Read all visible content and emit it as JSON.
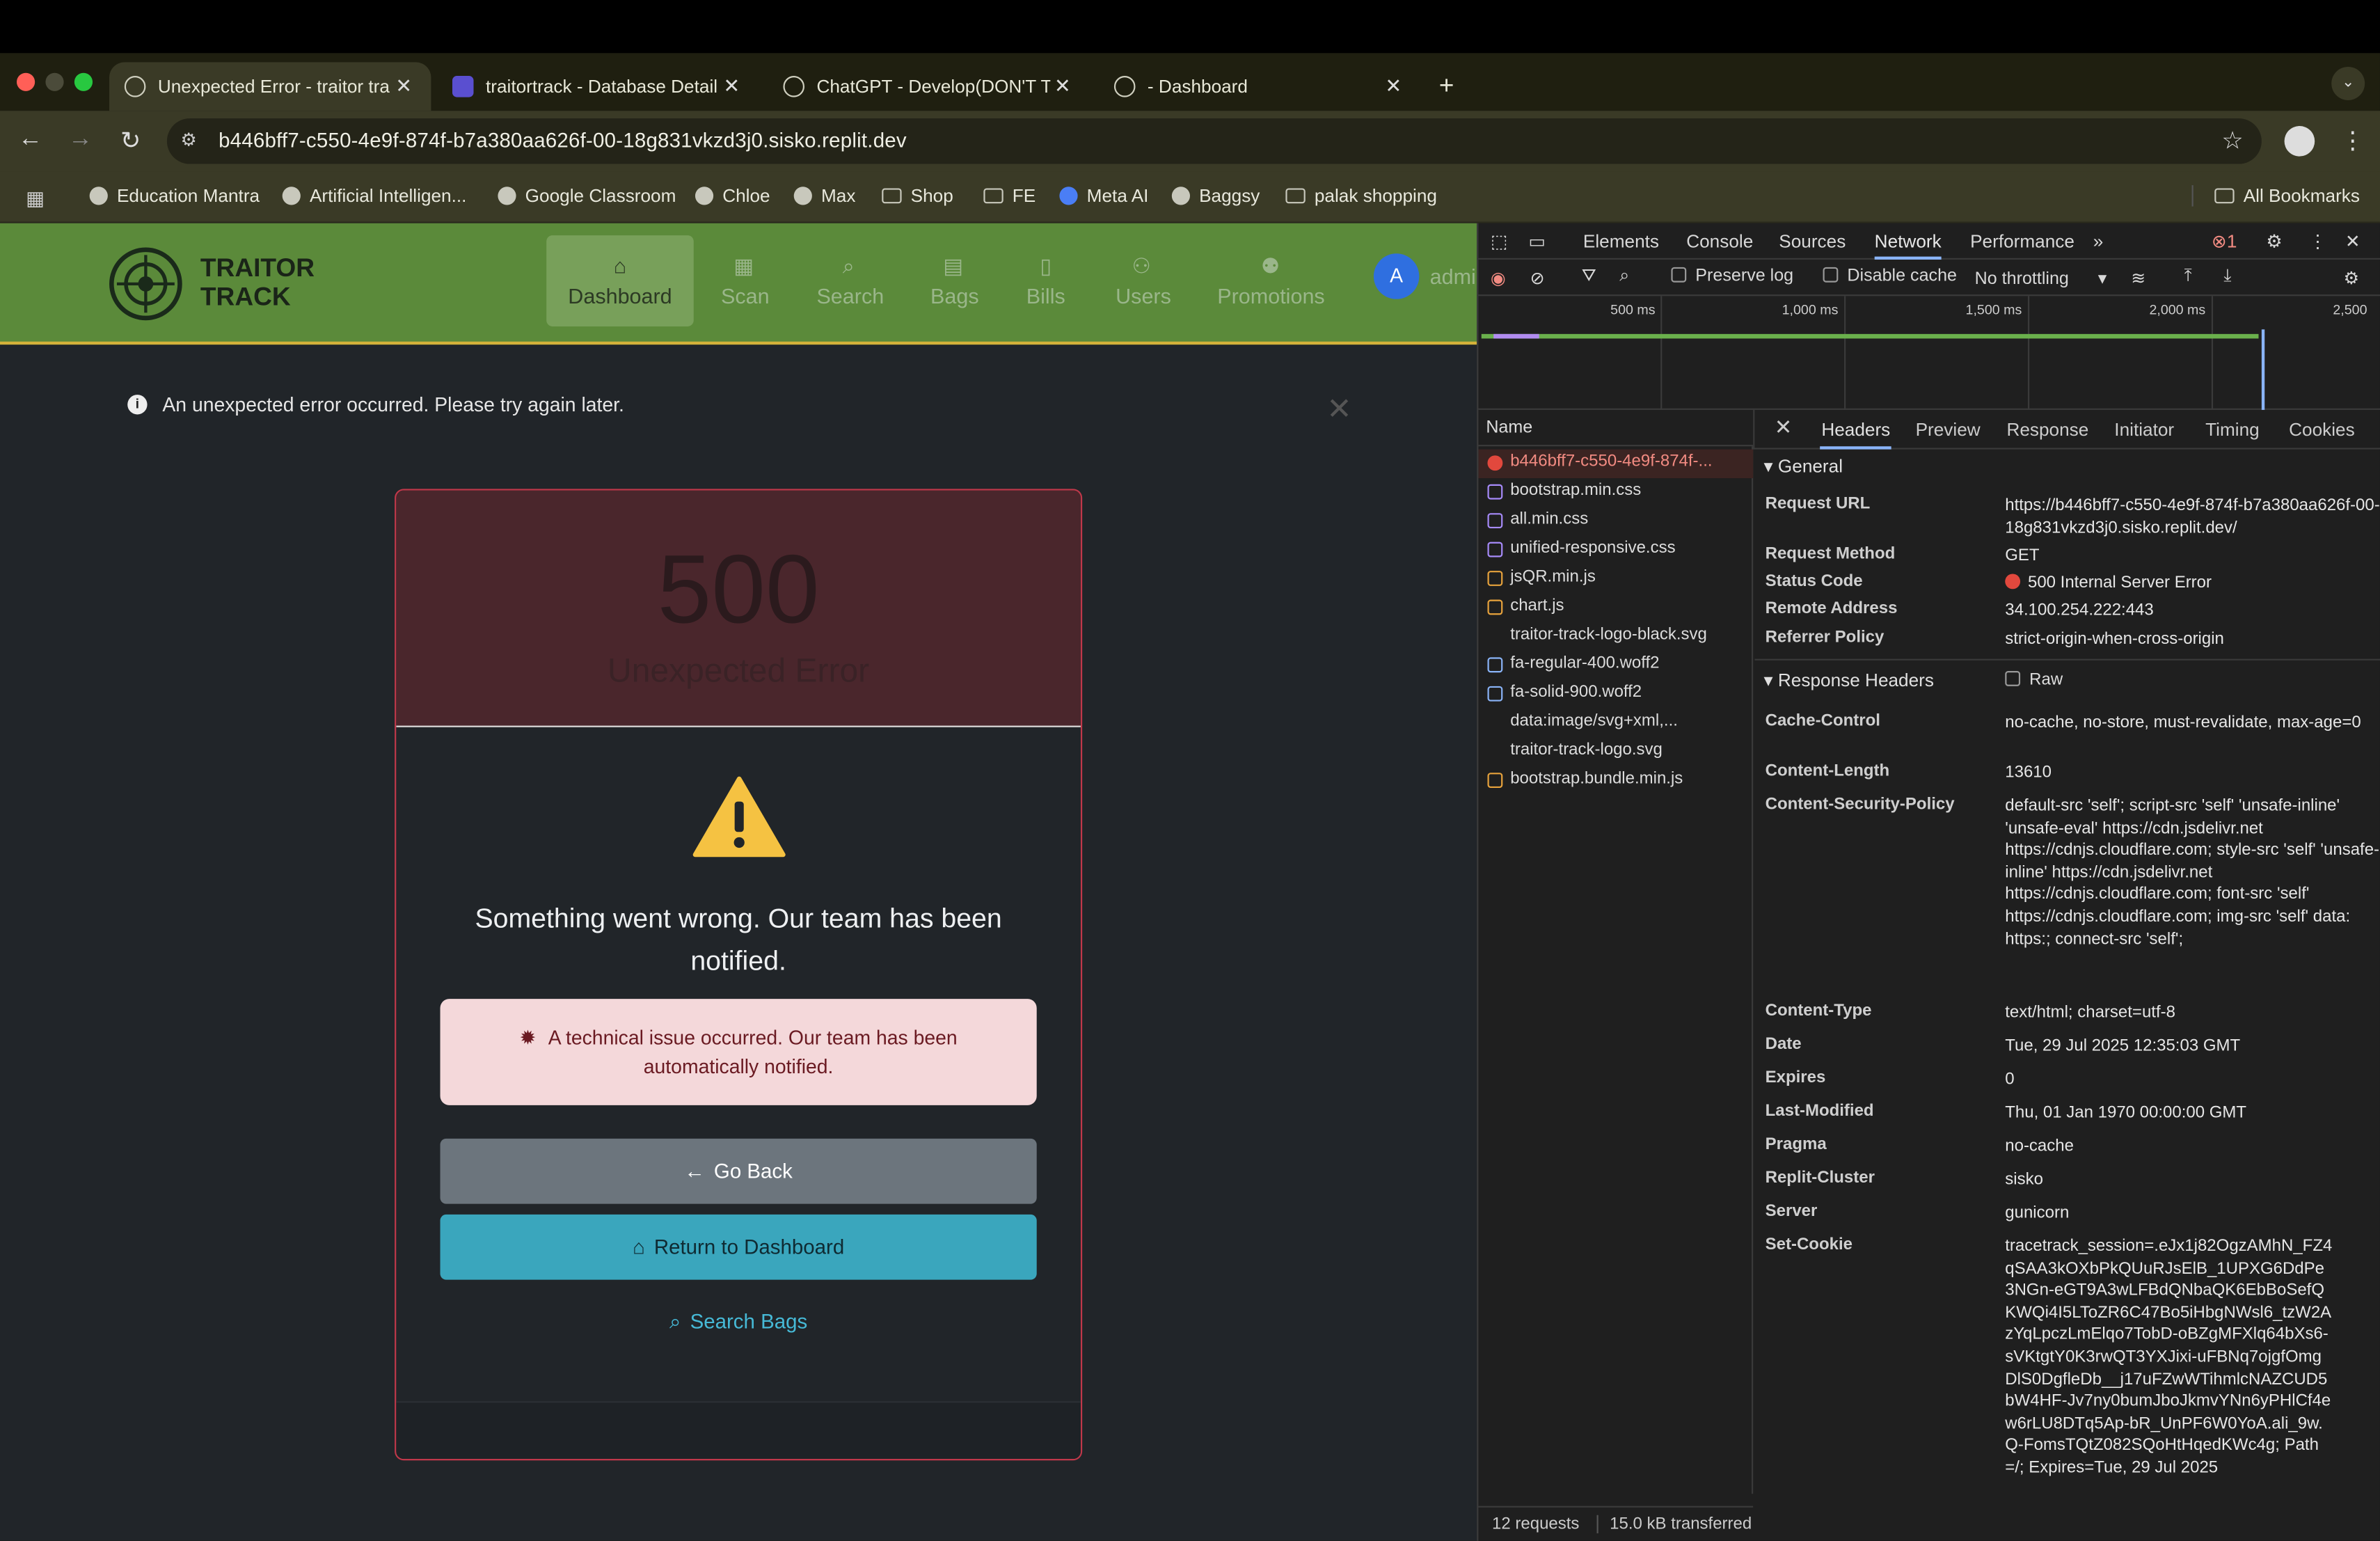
{
  "browser": {
    "tabs": [
      {
        "title": "Unexpected Error - traitor tra",
        "active": true
      },
      {
        "title": "traitortrack - Database Detail",
        "active": false
      },
      {
        "title": "ChatGPT - Develop(DON'T TC",
        "active": false
      },
      {
        "title": "- Dashboard",
        "active": false
      }
    ],
    "new_tab": "+",
    "url": "b446bff7-c550-4e9f-874f-b7a380aa626f-00-18g831vkzd3j0.sisko.replit.dev",
    "bookmarks": [
      "Education Mantra",
      "Artificial Intelligen...",
      "Google Classroom",
      "Chloe",
      "Max",
      "Shop",
      "FE",
      "Meta AI",
      "Baggsy",
      "palak shopping"
    ],
    "all_bookmarks": "All Bookmarks"
  },
  "app": {
    "logo_line1": "TRAITOR",
    "logo_line2": "TRACK",
    "nav": [
      "Dashboard",
      "Scan",
      "Search",
      "Bags",
      "Bills",
      "Users",
      "Promotions"
    ],
    "avatar_letter": "A",
    "user": "admi",
    "alert": "An unexpected error occurred. Please try again later.",
    "alert_close": "✕",
    "error_code": "500",
    "error_title": "Unexpected Error",
    "message": "Something went wrong. Our team has been notified.",
    "tech_notice": "A technical issue occurred. Our team has been automatically notified.",
    "go_back": "Go Back",
    "return_dashboard": "Return to Dashboard",
    "search_bags": "Search Bags"
  },
  "devtools": {
    "tabs": [
      "Elements",
      "Console",
      "Sources",
      "Network",
      "Performance"
    ],
    "more": "»",
    "issue_count": "1",
    "preserve_log": "Preserve log",
    "disable_cache": "Disable cache",
    "throttling": "No throttling",
    "ticks": [
      "500 ms",
      "1,000 ms",
      "1,500 ms",
      "2,000 ms",
      "2,500"
    ],
    "name_header": "Name",
    "requests": [
      {
        "name": "b446bff7-c550-4e9f-874f-...",
        "error": true
      },
      {
        "name": "bootstrap.min.css",
        "error": false
      },
      {
        "name": "all.min.css",
        "error": false
      },
      {
        "name": "unified-responsive.css",
        "error": false
      },
      {
        "name": "jsQR.min.js",
        "error": false
      },
      {
        "name": "chart.js",
        "error": false
      },
      {
        "name": "traitor-track-logo-black.svg",
        "error": false
      },
      {
        "name": "fa-regular-400.woff2",
        "error": false
      },
      {
        "name": "fa-solid-900.woff2",
        "error": false
      },
      {
        "name": "data:image/svg+xml,...",
        "error": false
      },
      {
        "name": "traitor-track-logo.svg",
        "error": false
      },
      {
        "name": "bootstrap.bundle.min.js",
        "error": false
      }
    ],
    "summary_requests": "12 requests",
    "summary_transfer": "15.0 kB transferred",
    "detail_tabs": [
      "Headers",
      "Preview",
      "Response",
      "Initiator",
      "Timing",
      "Cookies"
    ],
    "general_label": "General",
    "general": [
      {
        "k": "Request URL",
        "v": "https://b446bff7-c550-4e9f-874f-b7a380aa626f-00-18g831vkzd3j0.sisko.replit.dev/"
      },
      {
        "k": "Request Method",
        "v": "GET"
      },
      {
        "k": "Status Code",
        "v": "500 Internal Server Error"
      },
      {
        "k": "Remote Address",
        "v": "34.100.254.222:443"
      },
      {
        "k": "Referrer Policy",
        "v": "strict-origin-when-cross-origin"
      }
    ],
    "response_headers_label": "Response Headers",
    "raw_label": "Raw",
    "response_headers": [
      {
        "k": "Cache-Control",
        "v": "no-cache, no-store, must-revalidate, max-age=0"
      },
      {
        "k": "Content-Length",
        "v": "13610"
      },
      {
        "k": "Content-Security-Policy",
        "v": "default-src 'self'; script-src 'self' 'unsafe-inline' 'unsafe-eval' https://cdn.jsdelivr.net https://cdnjs.cloudflare.com; style-src 'self' 'unsafe-inline' https://cdn.jsdelivr.net https://cdnjs.cloudflare.com; font-src 'self' https://cdnjs.cloudflare.com; img-src 'self' data: https:; connect-src 'self';"
      },
      {
        "k": "Content-Type",
        "v": "text/html; charset=utf-8"
      },
      {
        "k": "Date",
        "v": "Tue, 29 Jul 2025 12:35:03 GMT"
      },
      {
        "k": "Expires",
        "v": "0"
      },
      {
        "k": "Last-Modified",
        "v": "Thu, 01 Jan 1970 00:00:00 GMT"
      },
      {
        "k": "Pragma",
        "v": "no-cache"
      },
      {
        "k": "Replit-Cluster",
        "v": "sisko"
      },
      {
        "k": "Server",
        "v": "gunicorn"
      },
      {
        "k": "Set-Cookie",
        "v": "tracetrack_session=.eJx1j82OgzAMhN_FZ4qSAA3kOXbPkQUuRJsElB_1UPXG6DdPe3NGn-eGT9A3wLFBdQNbaQK6EbBoSefQKWQi4I5LToZR6C47Bo5iHbgNWsl6_tzW2AzYqLpczLmElqo7TobD-oBZgMFXlq64bXs6-sVKtgtY0K3rwQT3YXJixi-uFBNq7ojgfOmgDlS0DgfleDb__j17uFZwWTihmlcNAZCUD5bW4HF-Jv7ny0bumJboJkmvYNn6yPHlCf4ew6rLU8DTq5Ap-bR_UnPF6W0YoA.ali_9w.Q-FomsTQtZ082SQoHtHqedKWc4g; Path=/; Expires=Tue, 29 Jul 2025"
      }
    ]
  }
}
